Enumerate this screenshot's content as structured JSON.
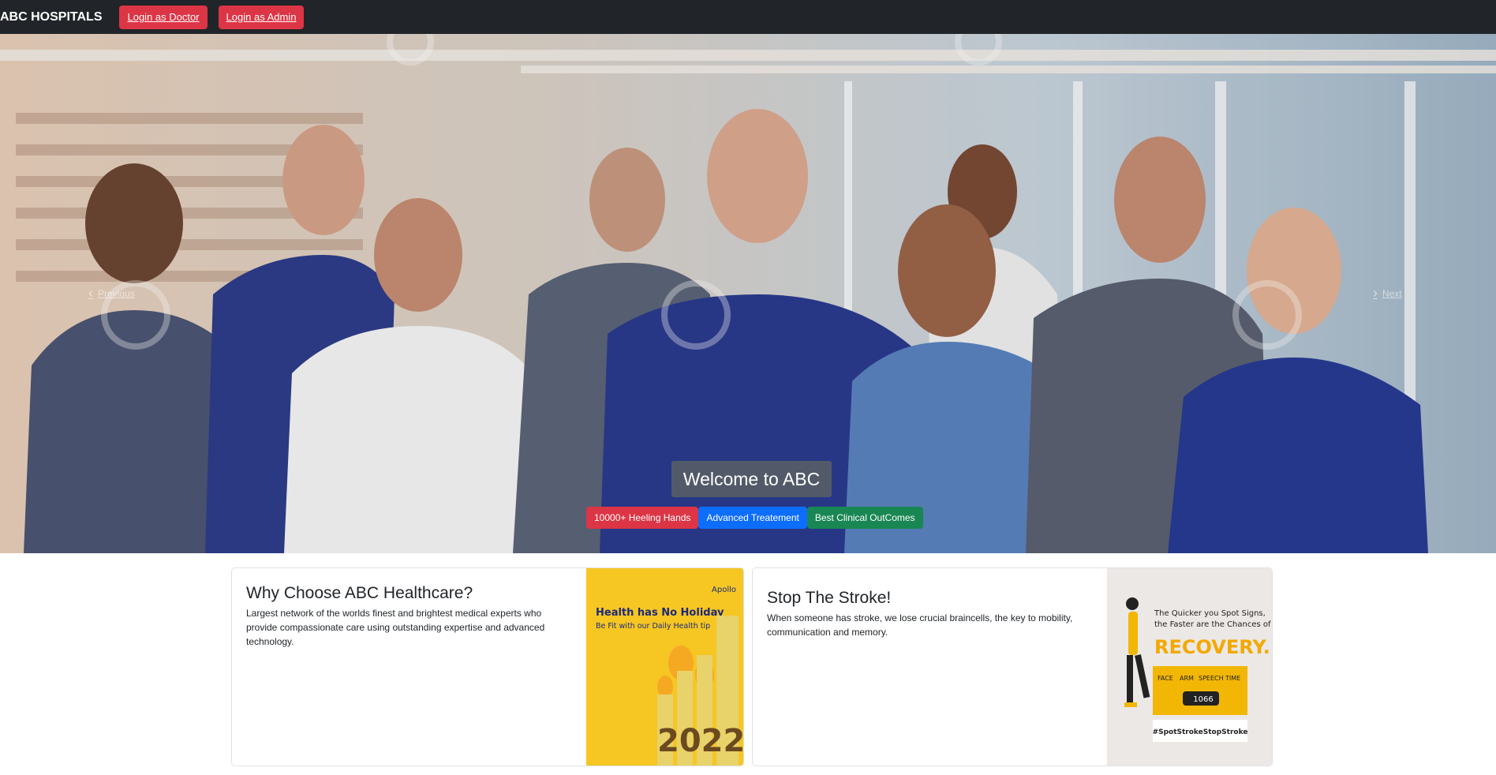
{
  "navbar": {
    "brand": "ABC HOSPITALS",
    "login_doctor": "Login as Doctor",
    "login_admin": "Login as Admin"
  },
  "carousel": {
    "prev_label": "Previous",
    "next_label": "Next",
    "caption_title": "Welcome to ABC",
    "badges": [
      "10000+ Heeling Hands",
      "Advanced Treatement",
      "Best Clinical OutComes"
    ]
  },
  "cards": [
    {
      "title": "Why Choose ABC Healthcare?",
      "text": "Largest network of the worlds finest and brightest medical experts who provide compassionate care using outstanding expertise and advanced technology.",
      "image": {
        "headline": "Health has No Holiday",
        "subline": "Be Fit with our Daily Health tip",
        "brand": "Apollo",
        "year": "2022"
      }
    },
    {
      "title": "Stop The Stroke!",
      "text": "When someone has stroke, we lose crucial braincells, the key to mobility, communication and memory.",
      "image": {
        "line1": "The Quicker you Spot Signs,",
        "line2": "the Faster are the Chances of",
        "headline": "RECOVERY.",
        "signs": [
          "FACE",
          "ARM",
          "SPEECH",
          "TIME"
        ],
        "phone": "1066",
        "hashtag": "#SpotStrokeStopStroke"
      }
    }
  ],
  "colors": {
    "navbar_bg": "#212529",
    "danger": "#dc3545",
    "primary": "#0d6efd",
    "success": "#198754"
  }
}
